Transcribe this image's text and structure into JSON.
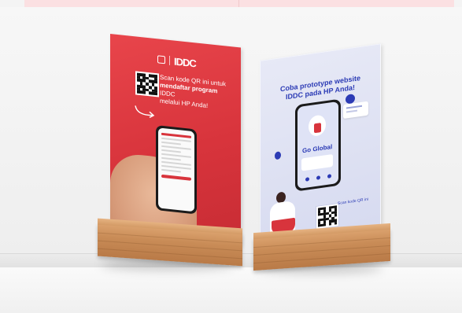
{
  "scene": {
    "left_flyer": {
      "brand": "IDDC",
      "scan_line1": "Scan kode QR ini untuk",
      "scan_line2_bold": "mendaftar program",
      "scan_line2_rest": " IDDC",
      "scan_line3": "melalui HP Anda!"
    },
    "right_flyer": {
      "headline_line1": "Coba prototype website",
      "headline_line2": "IDDC pada HP Anda!",
      "phone_text": "Go Global",
      "scan_text": "Scan kode QR ini"
    },
    "colors": {
      "red": "#d8343c",
      "blue": "#2c3bb5",
      "wood": "#c98c57"
    }
  }
}
